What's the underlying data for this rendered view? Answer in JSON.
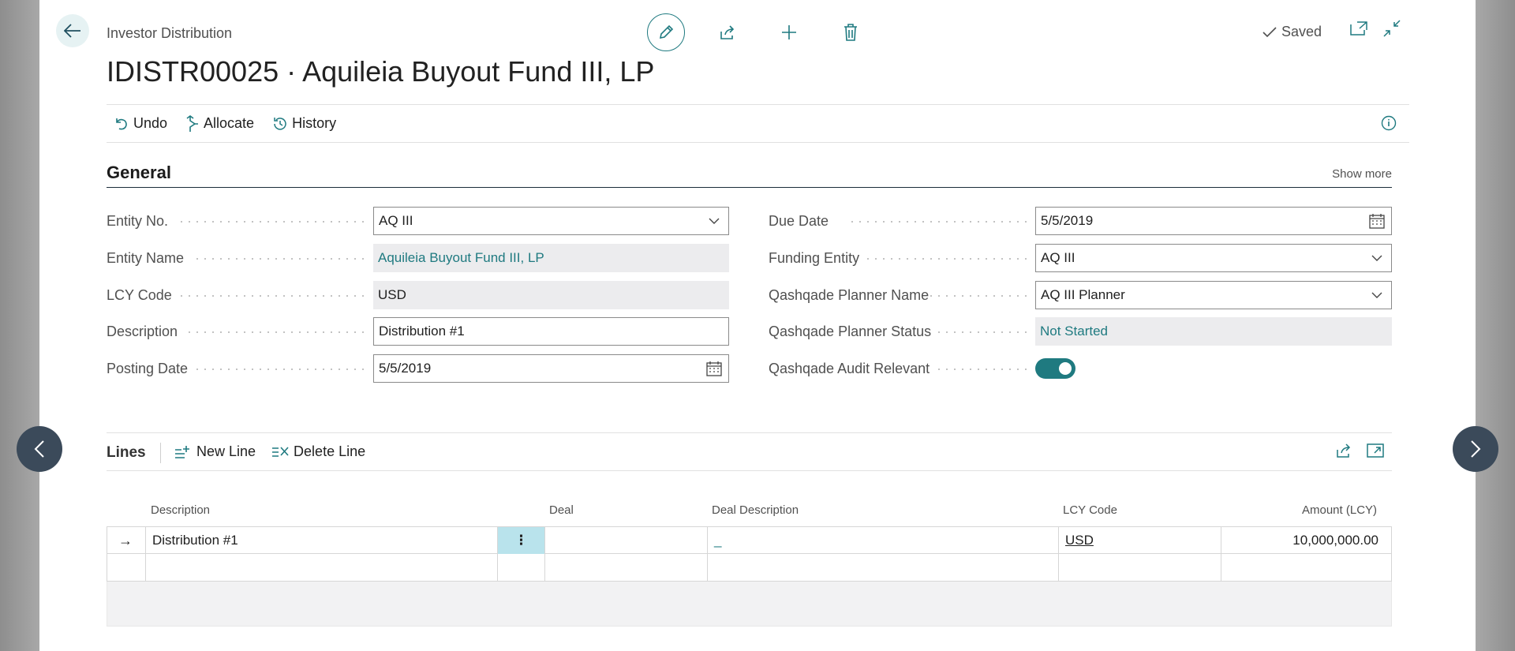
{
  "header": {
    "breadcrumb": "Investor Distribution",
    "title": "IDISTR00025 · Aquileia Buyout Fund III, LP",
    "saved_label": "Saved"
  },
  "actions": {
    "undo": "Undo",
    "allocate": "Allocate",
    "history": "History"
  },
  "general": {
    "title": "General",
    "show_more": "Show more",
    "left_fields": [
      {
        "label": "Entity No.",
        "value": "AQ III",
        "kind": "dropdown"
      },
      {
        "label": "Entity Name",
        "value": "Aquileia Buyout Fund III, LP",
        "kind": "readonly"
      },
      {
        "label": "LCY Code",
        "value": "USD",
        "kind": "readonly"
      },
      {
        "label": "Description",
        "value": "Distribution #1",
        "kind": "text"
      },
      {
        "label": "Posting Date",
        "value": "5/5/2019",
        "kind": "date"
      }
    ],
    "right_fields": [
      {
        "label": "Due Date",
        "value": "5/5/2019",
        "kind": "date"
      },
      {
        "label": "Funding Entity",
        "value": "AQ III",
        "kind": "dropdown"
      },
      {
        "label": "Qashqade Planner Name",
        "value": "AQ III Planner",
        "kind": "dropdown"
      },
      {
        "label": "Qashqade Planner Status",
        "value": "Not Started",
        "kind": "readonly"
      },
      {
        "label": "Qashqade Audit Relevant",
        "value": "on",
        "kind": "toggle"
      }
    ]
  },
  "lines": {
    "title": "Lines",
    "new_line": "New Line",
    "delete_line": "Delete Line",
    "columns": [
      "Description",
      "Deal",
      "Deal Description",
      "LCY Code",
      "Amount (LCY)"
    ],
    "rows": [
      {
        "description": "Distribution #1",
        "deal": "",
        "deal_description": "_",
        "lcy_code": "USD",
        "amount": "10,000,000.00"
      }
    ],
    "row_menu_glyph": "⋮",
    "row_arrow_glyph": "→"
  },
  "colors": {
    "accent": "#1f7a80",
    "readonly_bg": "#ececee",
    "nav_circle": "#3b4a5a",
    "selected_cell": "#b9e3ec"
  }
}
